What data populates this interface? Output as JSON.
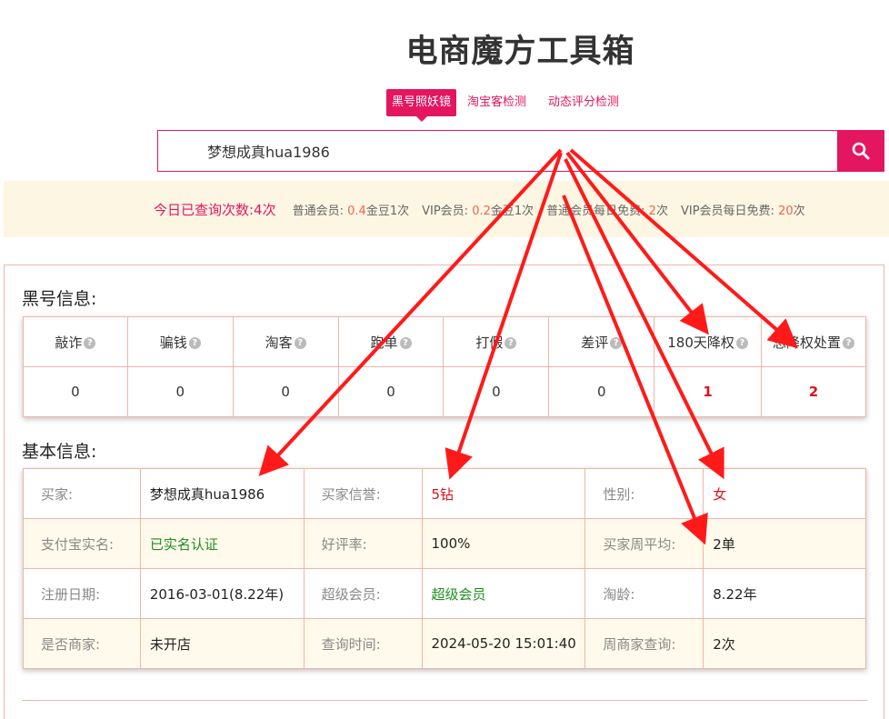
{
  "title": "电商魔方工具箱",
  "tabs": [
    {
      "label": "黑号照妖镜",
      "active": true
    },
    {
      "label": "淘宝客检测",
      "active": false
    },
    {
      "label": "动态评分检测",
      "active": false
    }
  ],
  "search": {
    "value": "梦想成真hua1986",
    "icon": "search-icon"
  },
  "info_bar": {
    "today_count": "今日已查询次数:4次",
    "normal_label": "普通会员: ",
    "normal_value": "0.4",
    "normal_suffix": "金豆1次",
    "vip_label": "VIP会员: ",
    "vip_value": "0.2",
    "vip_suffix": "金豆1次",
    "normal_free_label": "普通会员每日免费: ",
    "normal_free_value": "2",
    "normal_free_suffix": "次",
    "vip_free_label": "VIP会员每日免费: ",
    "vip_free_value": "20",
    "vip_free_suffix": "次"
  },
  "blacklist": {
    "title": "黑号信息:",
    "columns": [
      "敲诈",
      "骗钱",
      "淘客",
      "跑单",
      "打假",
      "差评",
      "180天降权",
      "总降权处置"
    ],
    "values": [
      "0",
      "0",
      "0",
      "0",
      "0",
      "0",
      "1",
      "2"
    ],
    "help_icon": "?"
  },
  "basic": {
    "title": "基本信息:",
    "rows": [
      [
        {
          "label": "买家:",
          "value": "梦想成真hua1986"
        },
        {
          "label": "买家信誉:",
          "value": "5钻"
        },
        {
          "label": "性别:",
          "value": "女"
        }
      ],
      [
        {
          "label": "支付宝实名:",
          "value": "已实名认证"
        },
        {
          "label": "好评率:",
          "value": "100%"
        },
        {
          "label": "买家周平均:",
          "value": "2单"
        }
      ],
      [
        {
          "label": "注册日期:",
          "value": "2016-03-01(8.22年)"
        },
        {
          "label": "超级会员:",
          "value": "超级会员"
        },
        {
          "label": "淘龄:",
          "value": "8.22年"
        }
      ],
      [
        {
          "label": "是否商家:",
          "value": "未开店"
        },
        {
          "label": "查询时间:",
          "value": "2024-05-20 15:01:40"
        },
        {
          "label": "周商家查询:",
          "value": "2次"
        }
      ]
    ]
  },
  "colors": {
    "accent": "#e4165f",
    "red_value": "#e0101a",
    "green_value": "#1f8e20",
    "arrow": "#ff1a1a"
  }
}
